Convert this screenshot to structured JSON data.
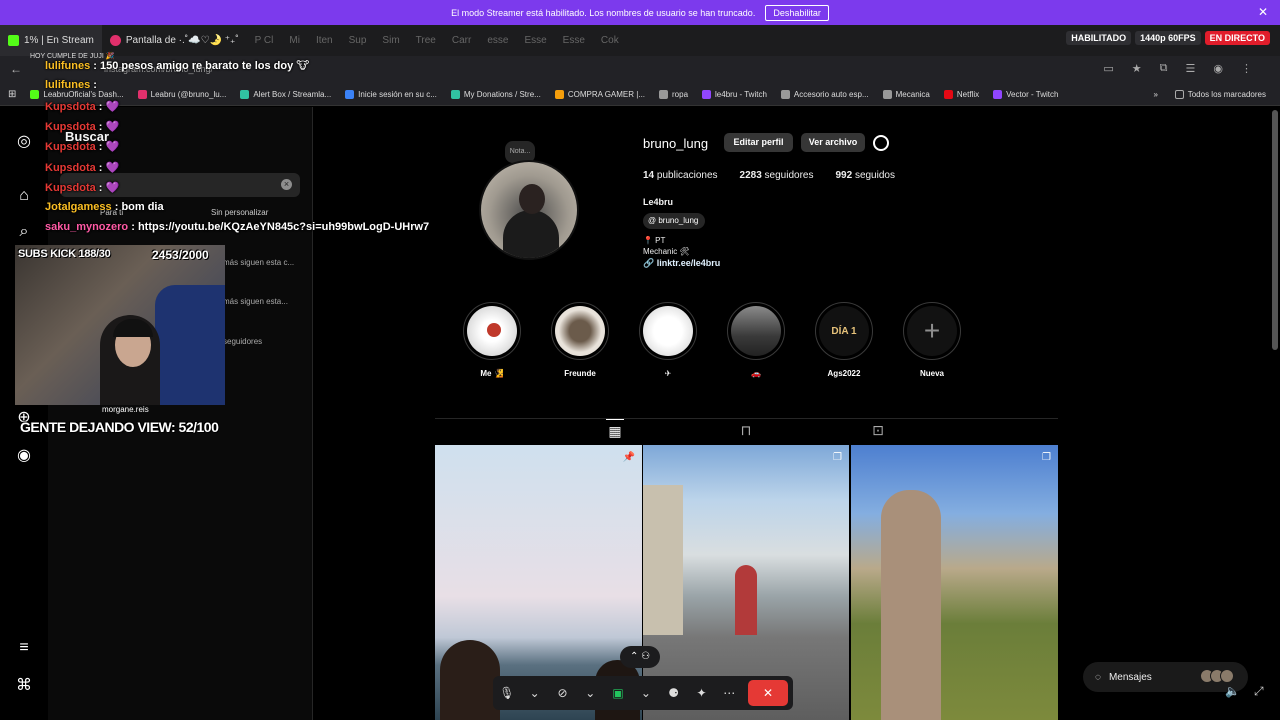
{
  "banner": {
    "text": "El modo Streamer está habilitado. Los nombres de usuario se han truncado.",
    "button": "Deshabilitar",
    "close": "✕"
  },
  "tabs": [
    {
      "label": "1% | En Stream"
    },
    {
      "label": "Pantalla de ·.˚☁️♡🌛 ⁺₊˚"
    },
    {
      "label": "P Cl"
    },
    {
      "label": "Mi"
    },
    {
      "label": "Iten"
    },
    {
      "label": "Sup"
    },
    {
      "label": "Sim"
    },
    {
      "label": "Tree"
    },
    {
      "label": "Carr"
    },
    {
      "label": "esse"
    },
    {
      "label": "Esse"
    },
    {
      "label": "Esse"
    },
    {
      "label": "Cok"
    }
  ],
  "stream": {
    "enabled": "HABILITADO",
    "quality": "1440p 60FPS",
    "live": "EN DIRECTO"
  },
  "address": {
    "url": "instagram.com/bruno_lung/"
  },
  "bookmarks": [
    {
      "label": "LeabruOficial's Dash...",
      "color": "#53fc18"
    },
    {
      "label": "Leabru (@bruno_lu...",
      "color": "#e1306c"
    },
    {
      "label": "Alert Box / Streamla...",
      "color": "#31c3a2"
    },
    {
      "label": "Inicie sesión en su c...",
      "color": "#3b82f6"
    },
    {
      "label": "My Donations / Stre...",
      "color": "#31c3a2"
    },
    {
      "label": "COMPRA GAMER |...",
      "color": "#f59e0b"
    },
    {
      "label": "ropa",
      "color": "#999999"
    },
    {
      "label": "le4bru - Twitch",
      "color": "#9146ff"
    },
    {
      "label": "Accesorio auto esp...",
      "color": "#999999"
    },
    {
      "label": "Mecanica",
      "color": "#999999"
    },
    {
      "label": "Netflix",
      "color": "#e50914"
    },
    {
      "label": "Vector - Twitch",
      "color": "#9146ff"
    }
  ],
  "bookmarks_all": "Todos los marcadores",
  "search_panel": {
    "title": "Buscar",
    "recent": "Para ti",
    "no_customize": "Sin personalizar",
    "lines": [
      "más siguen esta c...",
      "más siguen esta...",
      "seguidores"
    ]
  },
  "chat": {
    "hoy": "HOY CUMPLE DE JUJI 🎉",
    "lines": [
      {
        "user": "lulifunes",
        "msg": ": 150 pesos amigo re barato te los doy 🐮",
        "cls": "u-yel"
      },
      {
        "user": "lulifunes",
        "msg": ":",
        "cls": "u-yel"
      },
      {
        "user": "Kupsdota",
        "msg": ": 💜",
        "cls": "u-red"
      },
      {
        "user": "Kupsdota",
        "msg": ": 💜",
        "cls": "u-red"
      },
      {
        "user": "Kupsdota",
        "msg": ": 💜",
        "cls": "u-red"
      },
      {
        "user": "Kupsdota",
        "msg": ": 💜",
        "cls": "u-red"
      },
      {
        "user": "Kupsdota",
        "msg": ": 💜",
        "cls": "u-red"
      },
      {
        "user": "Jotalgamess",
        "msg": ": bom dia",
        "cls": "u-yel"
      },
      {
        "user": "saku_mynozero",
        "msg": ": https://youtu.be/KQzAeYN845c?si=uh99bwLogD-UHrw7",
        "cls": "u-pink"
      }
    ]
  },
  "overlay": {
    "subs": "SUBS KICK 188/30",
    "subs_count": "2453/2000",
    "gente": "GENTE DEJANDO VIEW: 52/100",
    "morgane": "morgane.reis"
  },
  "profile": {
    "nota": "Nota...",
    "username": "bruno_lung",
    "edit": "Editar perfil",
    "archive": "Ver archivo",
    "posts_n": "14",
    "posts_l": "publicaciones",
    "followers_n": "2283",
    "followers_l": "seguidores",
    "following_n": "992",
    "following_l": "seguidos",
    "full_name": "Le4bru",
    "threads": "bruno_lung",
    "bio1": "📍 PT",
    "bio2": "Mechanic 🛠",
    "link": "linktr.ee/le4bru"
  },
  "highlights": [
    {
      "label": "Me 🧏"
    },
    {
      "label": "Freunde"
    },
    {
      "label": "✈"
    },
    {
      "label": "🚗"
    },
    {
      "label": "Ags2022",
      "inner": "DÍA 1"
    },
    {
      "label": "Nueva"
    }
  ],
  "messages": {
    "label": "Mensajes"
  }
}
